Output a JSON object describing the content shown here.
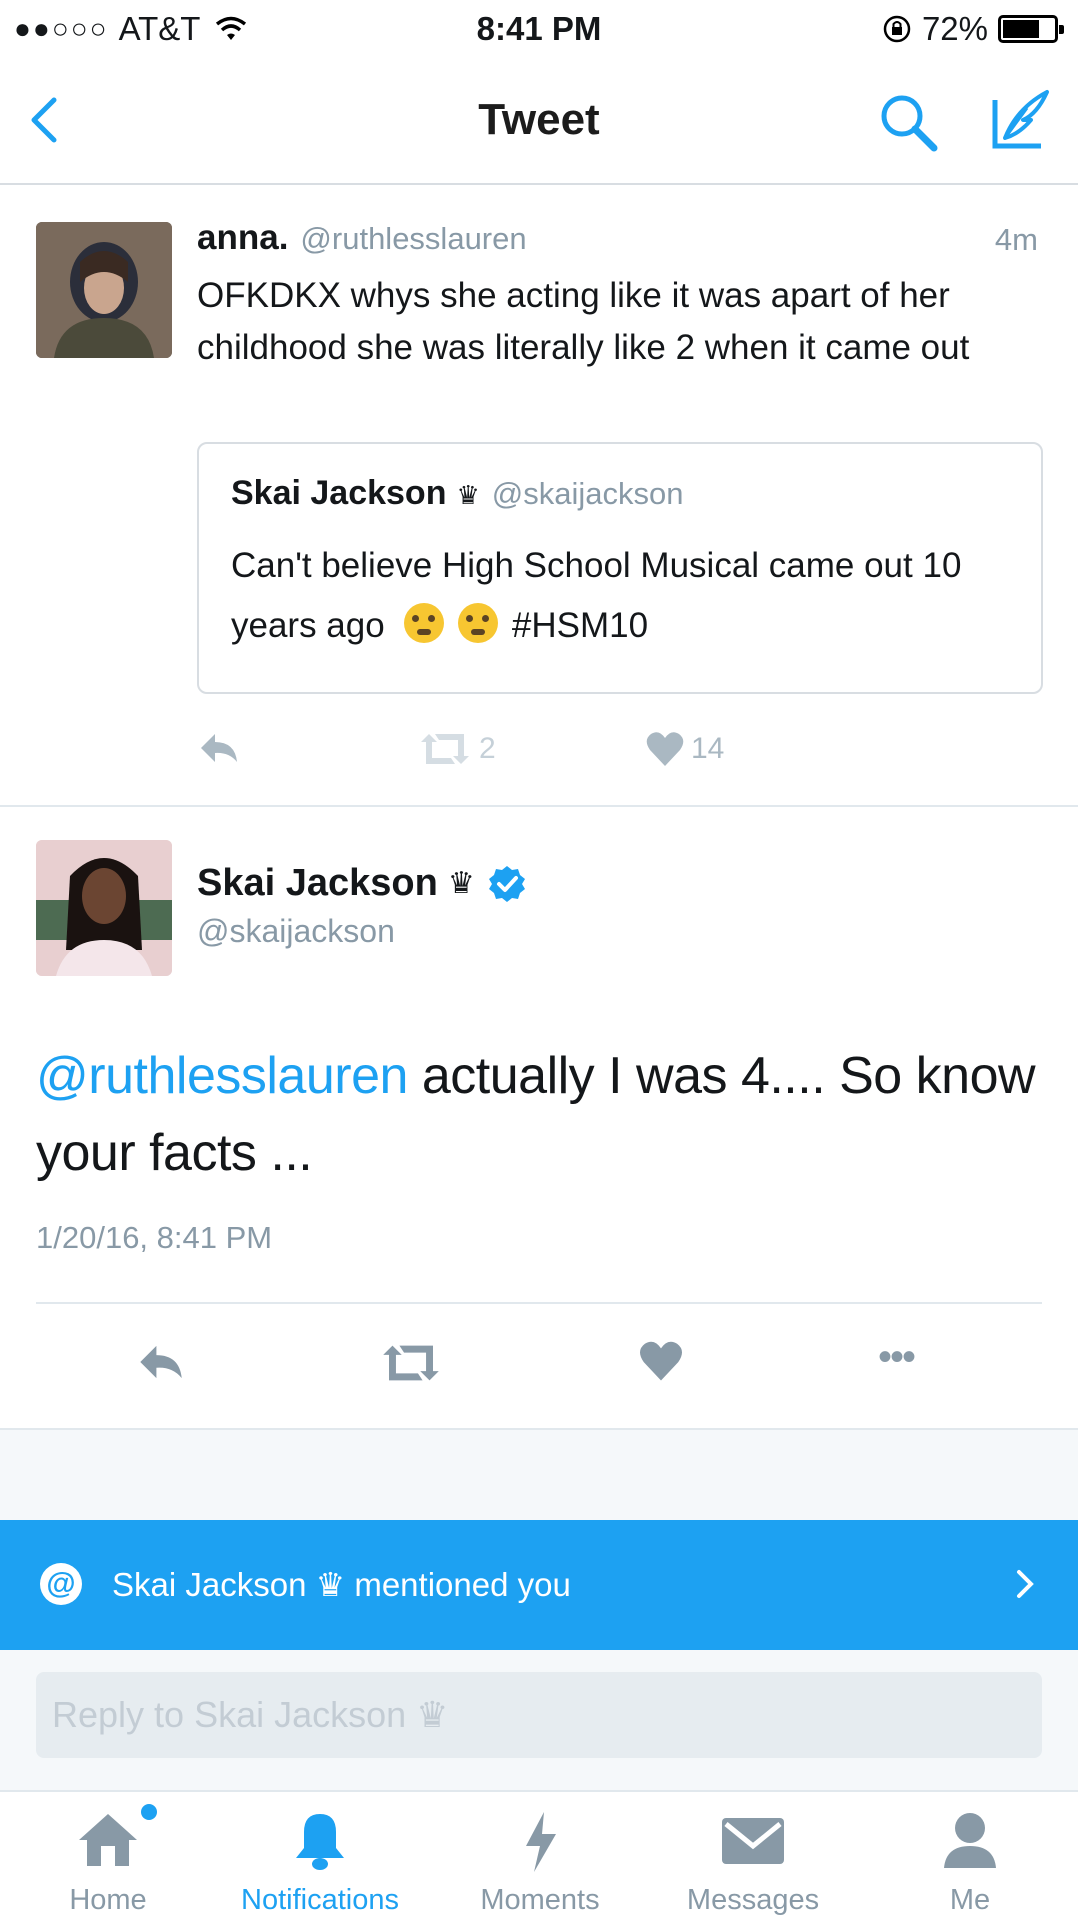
{
  "status_bar": {
    "signal": "●●○○○",
    "carrier": "AT&T",
    "time": "8:41 PM",
    "battery_percent": "72%",
    "battery_level": 0.72
  },
  "nav": {
    "title": "Tweet"
  },
  "reply_tweet": {
    "name": "anna.",
    "handle": "@ruthlesslauren",
    "time": "4m",
    "text": "OFKDKX whys she acting like it was apart of her childhood she was literally like 2 when it came out",
    "quoted": {
      "name": "Skai Jackson",
      "crown": "♛",
      "handle": "@skaijackson",
      "text_before": "Can't believe High School Musical came out 10 years ago",
      "hashtag": "#HSM10"
    },
    "retweets": "2",
    "likes": "14"
  },
  "main_tweet": {
    "name": "Skai Jackson",
    "crown": "♛",
    "handle": "@skaijackson",
    "mention": "@ruthlesslauren",
    "text": " actually I was 4.... So know your facts ...",
    "date": "1/20/16, 8:41 PM",
    "more": "•••"
  },
  "banner": {
    "at_symbol": "@",
    "text": "Skai Jackson ♛ mentioned you"
  },
  "reply": {
    "placeholder": "Reply to Skai Jackson ♛"
  },
  "tabs": [
    {
      "label": "Home",
      "icon": "home-icon"
    },
    {
      "label": "Notifications",
      "icon": "bell-icon"
    },
    {
      "label": "Moments",
      "icon": "lightning-icon"
    },
    {
      "label": "Messages",
      "icon": "envelope-icon"
    },
    {
      "label": "Me",
      "icon": "person-icon"
    }
  ],
  "colors": {
    "accent": "#1da1f2",
    "muted": "#8899a6"
  }
}
